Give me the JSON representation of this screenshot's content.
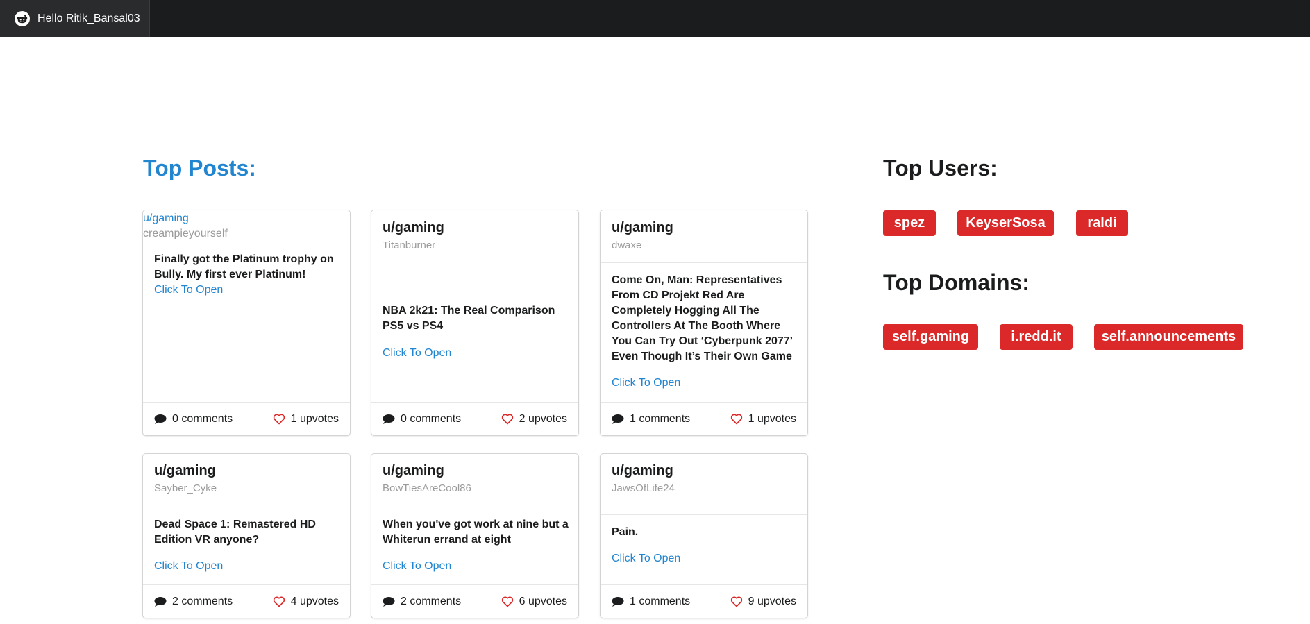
{
  "navbar": {
    "greeting": "Hello Ritik_Bansal03",
    "icon": "reddit-icon"
  },
  "top_posts": {
    "heading": "Top Posts:",
    "posts": [
      {
        "subreddit": "u/gaming",
        "author": "creampieyourself",
        "title": "Finally got the Platinum trophy on Bully. My first ever Platinum!",
        "link": "Click To Open",
        "comments": "0 comments",
        "upvotes": "1 upvotes"
      },
      {
        "subreddit": "u/gaming",
        "author": "Titanburner",
        "title": "NBA 2k21: The Real Comparison PS5 vs PS4",
        "link": "Click To Open",
        "comments": "0 comments",
        "upvotes": "2 upvotes"
      },
      {
        "subreddit": "u/gaming",
        "author": "dwaxe",
        "title": "Come On, Man: Representatives From CD Projekt Red Are Completely Hogging All The Controllers At The Booth Where You Can Try Out ‘Cyberpunk 2077’ Even Though It’s Their Own Game",
        "link": "Click To Open",
        "comments": "1 comments",
        "upvotes": "1 upvotes"
      },
      {
        "subreddit": "u/gaming",
        "author": "Sayber_Cyke",
        "title": "Dead Space 1: Remastered HD Edition VR anyone?",
        "link": "Click To Open",
        "comments": "2 comments",
        "upvotes": "4 upvotes"
      },
      {
        "subreddit": "u/gaming",
        "author": "BowTiesAreCool86",
        "title": "When you've got work at nine but a Whiterun errand at eight",
        "link": "Click To Open",
        "comments": "2 comments",
        "upvotes": "6 upvotes"
      },
      {
        "subreddit": "u/gaming",
        "author": "JawsOfLife24",
        "title": "Pain.",
        "link": "Click To Open",
        "comments": "1 comments",
        "upvotes": "9 upvotes"
      }
    ]
  },
  "top_users": {
    "heading": "Top Users:",
    "users": [
      "spez",
      "KeyserSosa",
      "raldi"
    ]
  },
  "top_domains": {
    "heading": "Top Domains:",
    "domains": [
      "self.gaming",
      "i.redd.it",
      "self.announcements"
    ]
  },
  "colors": {
    "navbar": "#1b1c1d",
    "link": "#2185d0",
    "label": "#db2828",
    "heart": "#db2828"
  }
}
